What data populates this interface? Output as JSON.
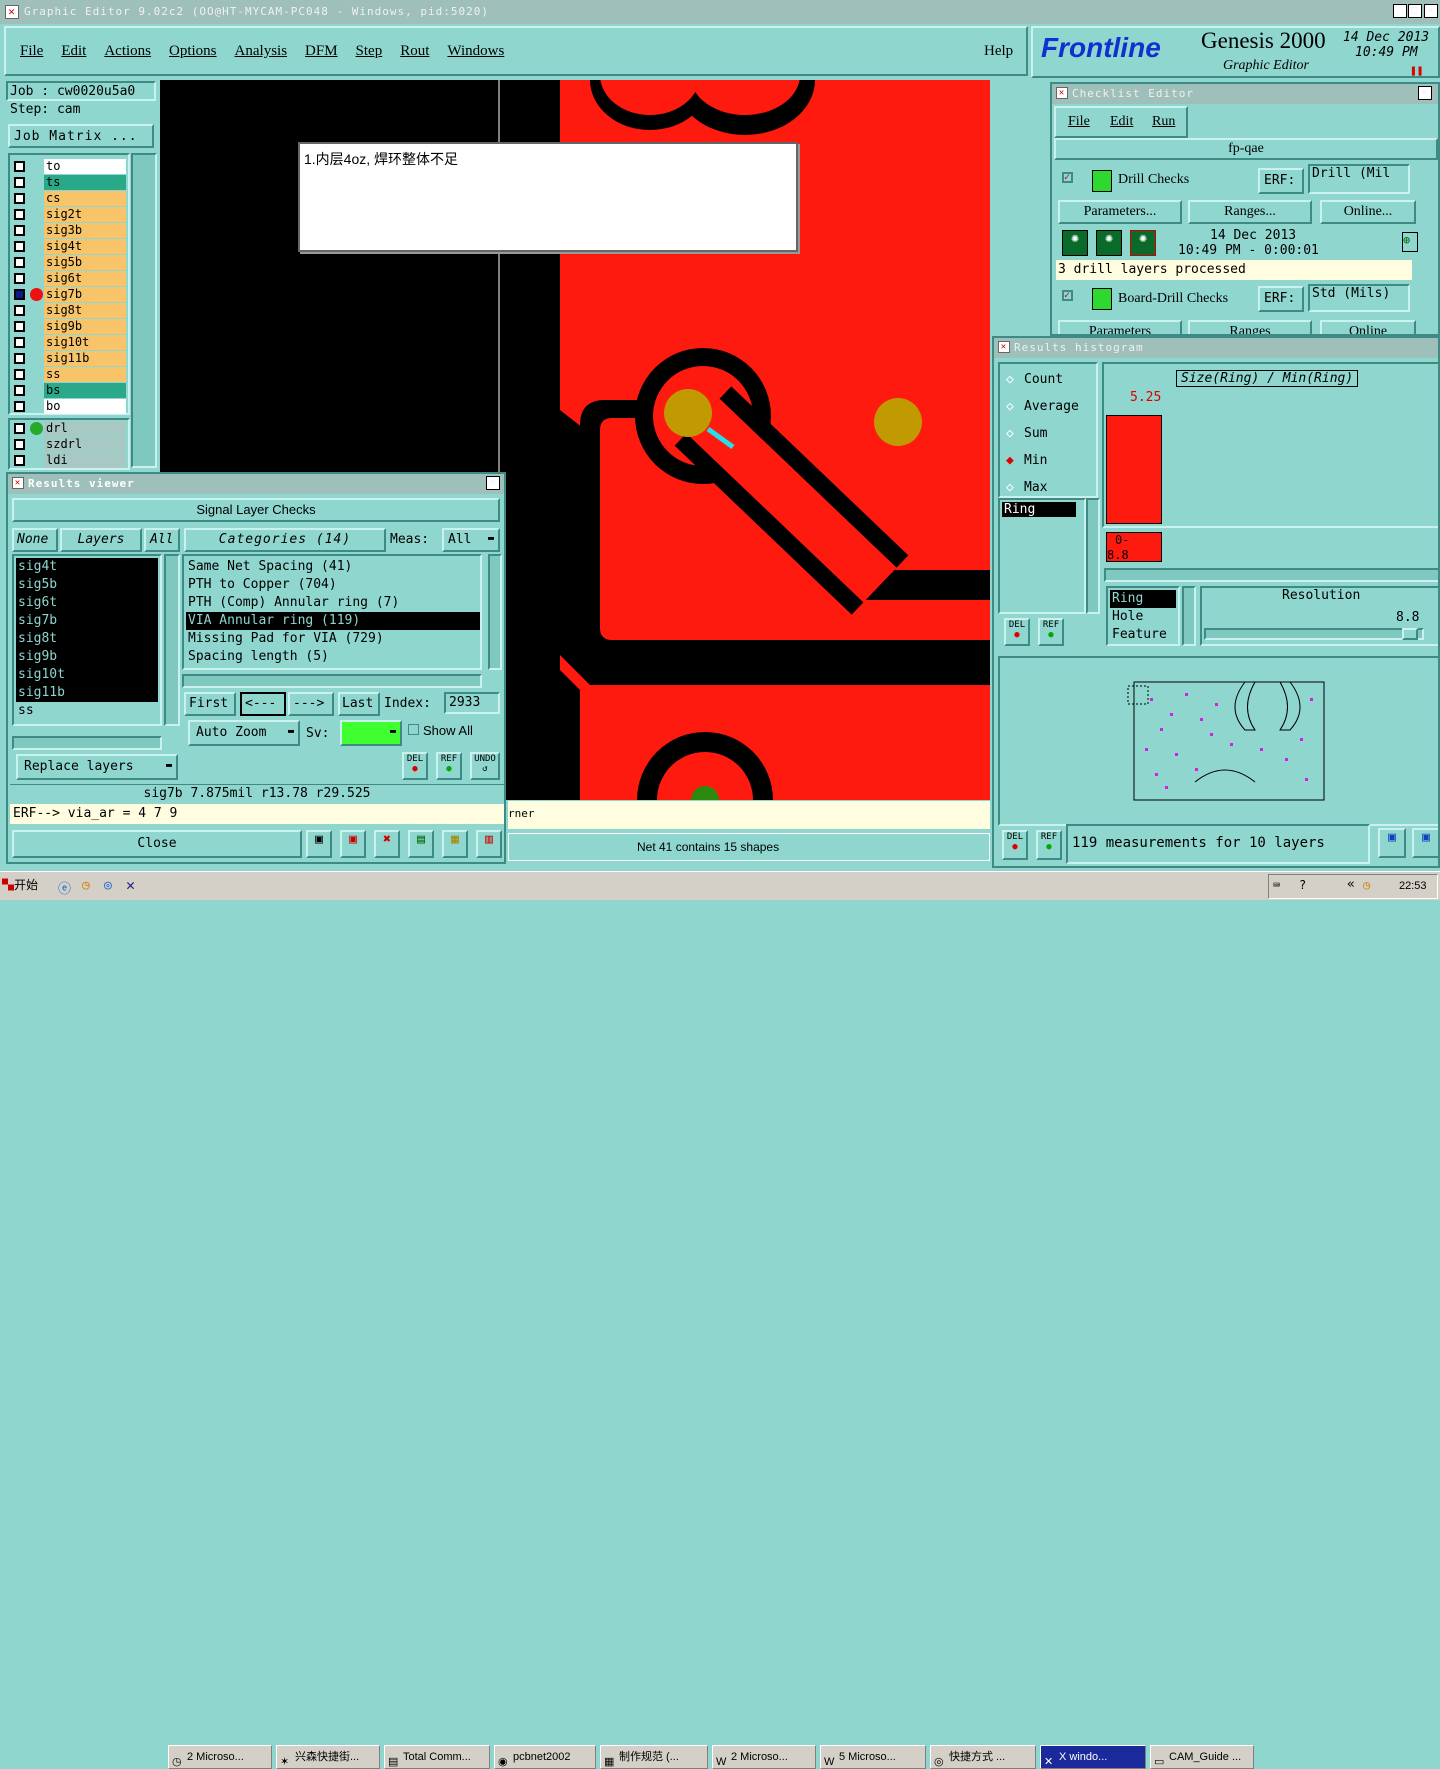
{
  "window": {
    "title": "Graphic Editor 9.02c2  (OO@HT-MYCAM-PC048 - Windows, pid:5020)"
  },
  "menubar": {
    "items": [
      "File",
      "Edit",
      "Actions",
      "Options",
      "Analysis",
      "DFM",
      "Step",
      "Rout",
      "Windows"
    ],
    "help": "Help"
  },
  "brand": {
    "logo": "Frontline",
    "product": "Genesis 2000",
    "subtitle": "Graphic Editor",
    "date": "14 Dec 2013",
    "time": "10:49  PM"
  },
  "job": {
    "job": "Job  : cw0020u5a0",
    "step": "Step: cam",
    "matrix_button": "Job Matrix ..."
  },
  "layers": [
    {
      "name": "to",
      "color": "#ffffff"
    },
    {
      "name": "ts",
      "color": "#2aa88a"
    },
    {
      "name": "cs",
      "color": "#f8c46a"
    },
    {
      "name": "sig2t",
      "color": "#f8c46a"
    },
    {
      "name": "sig3b",
      "color": "#f8c46a"
    },
    {
      "name": "sig4t",
      "color": "#f8c46a"
    },
    {
      "name": "sig5b",
      "color": "#f8c46a"
    },
    {
      "name": "sig6t",
      "color": "#f8c46a"
    },
    {
      "name": "sig7b",
      "color": "#f8c46a"
    },
    {
      "name": "sig8t",
      "color": "#f8c46a"
    },
    {
      "name": "sig9b",
      "color": "#f8c46a"
    },
    {
      "name": "sig10t",
      "color": "#f8c46a"
    },
    {
      "name": "sig11b",
      "color": "#f8c46a"
    },
    {
      "name": "ss",
      "color": "#f8c46a"
    },
    {
      "name": "bs",
      "color": "#2aa88a"
    },
    {
      "name": "bo",
      "color": "#ffffff"
    }
  ],
  "drill_layers": [
    "drl",
    "szdrl",
    "ldi"
  ],
  "note": {
    "text": "1.内层4oz, 焊环整体不足"
  },
  "canvas": {
    "status_text": "Net 41 contains 15 shapes",
    "partial_text": "rner"
  },
  "results_viewer": {
    "title": "Results viewer",
    "group": "Signal Layer Checks",
    "none": "None",
    "layers_label": "Layers",
    "all": "All",
    "categories_label": "Categories (14)",
    "meas_label": "Meas:",
    "meas_value": "All",
    "layer_list": [
      "sig4t",
      "sig5b",
      "sig6t",
      "sig7b",
      "sig8t",
      "sig9b",
      "sig10t",
      "sig11b",
      "ss"
    ],
    "categories": [
      "Same Net Spacing (41)",
      "PTH to Copper (704)",
      "PTH (Comp) Annular ring (7)",
      "VIA Annular ring (119)",
      "Missing Pad for VIA (729)",
      "Spacing length (5)"
    ],
    "selected_category": "VIA Annular ring (119)",
    "first": "First",
    "prev": "<---",
    "next": "--->",
    "last": "Last",
    "index_label": "Index:",
    "index_value": "2933",
    "autozoom": "Auto Zoom",
    "sv_label": "Sv:",
    "show_all": "Show All",
    "replace": "Replace layers",
    "del": "DEL",
    "ref": "REF",
    "undo": "UNDO",
    "status": "sig7b 7.875mil   r13.78   r29.525",
    "erf": "ERF--> via_ar = 4 7 9",
    "close": "Close"
  },
  "checklist": {
    "title": "Checklist Editor",
    "menu": [
      "File",
      "Edit",
      "Run"
    ],
    "name": "fp-qae",
    "check1": {
      "name": "Drill Checks",
      "erf_label": "ERF:",
      "erf_value": "Drill (Mil"
    },
    "buttons": [
      "Parameters...",
      "Ranges...",
      "Online..."
    ],
    "run_date": "14 Dec 2013",
    "run_time": "10:49 PM - 0:00:01",
    "message": "3 drill layers processed",
    "check2": {
      "name": "Board-Drill Checks",
      "erf_label": "ERF:",
      "erf_value": "Std (Mils)"
    },
    "buttons2": [
      "Parameters",
      "Ranges",
      "Online"
    ]
  },
  "histogram": {
    "title": "Results histogram",
    "options": [
      "Count",
      "Average",
      "Sum",
      "Min",
      "Max"
    ],
    "selected_option": "Min",
    "list": [
      "Ring"
    ],
    "heading": "Size(Ring) / Min(Ring)",
    "bar_value": "5.25",
    "bar_fraction": 0.68,
    "range_label": "0-\n8.8",
    "list2": [
      "Ring",
      "Hole",
      "Feature"
    ],
    "resolution_label": "Resolution",
    "resolution_value": "8.8",
    "summary": "119 measurements for 10 layers",
    "del": "DEL",
    "ref": "REF"
  },
  "taskbar": {
    "start": "开始",
    "items": [
      "2 Microso...",
      "兴森快捷街...",
      "Total Comm...",
      "pcbnet2002",
      "制作规范 (...",
      "2 Microso...",
      "5 Microso...",
      "快捷方式 ...",
      "X windo...",
      "CAM_Guide ..."
    ],
    "time": "22:53"
  },
  "colors": {
    "copper": "#ff1a10",
    "background": "#000000",
    "pad": "#c09a00",
    "ui": "#8fd6cf",
    "highlight": "#25e0e8"
  }
}
